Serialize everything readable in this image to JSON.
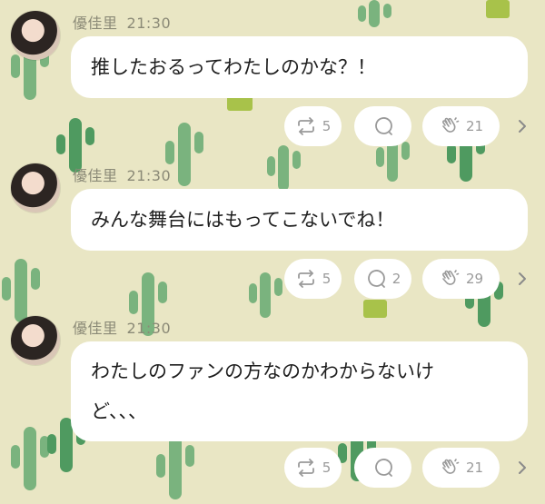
{
  "colors": {
    "background": "#e9e6c4",
    "cactus_light": "#7ab37e",
    "cactus_dark": "#4f9a60",
    "pot": "#a8c24a"
  },
  "messages": [
    {
      "author": "優佳里",
      "time": "21:30",
      "text": "推したおるってわたしのかな？！",
      "icons": [
        "repost-icon",
        "comment-icon",
        "clap-icon"
      ],
      "repost_count": "5",
      "comment_count": "",
      "clap_count": "21"
    },
    {
      "author": "優佳里",
      "time": "21:30",
      "text": "みんな舞台にはもってこないでね！",
      "icons": [
        "repost-icon",
        "comment-icon",
        "clap-icon"
      ],
      "repost_count": "5",
      "comment_count": "2",
      "clap_count": "29"
    },
    {
      "author": "優佳里",
      "time": "21:30",
      "text_lines": [
        "わたしのファンの方なのかわからないけ",
        "ど、、、"
      ],
      "icons": [
        "repost-icon",
        "comment-icon",
        "clap-icon"
      ],
      "repost_count": "5",
      "comment_count": "",
      "clap_count": "21"
    }
  ]
}
